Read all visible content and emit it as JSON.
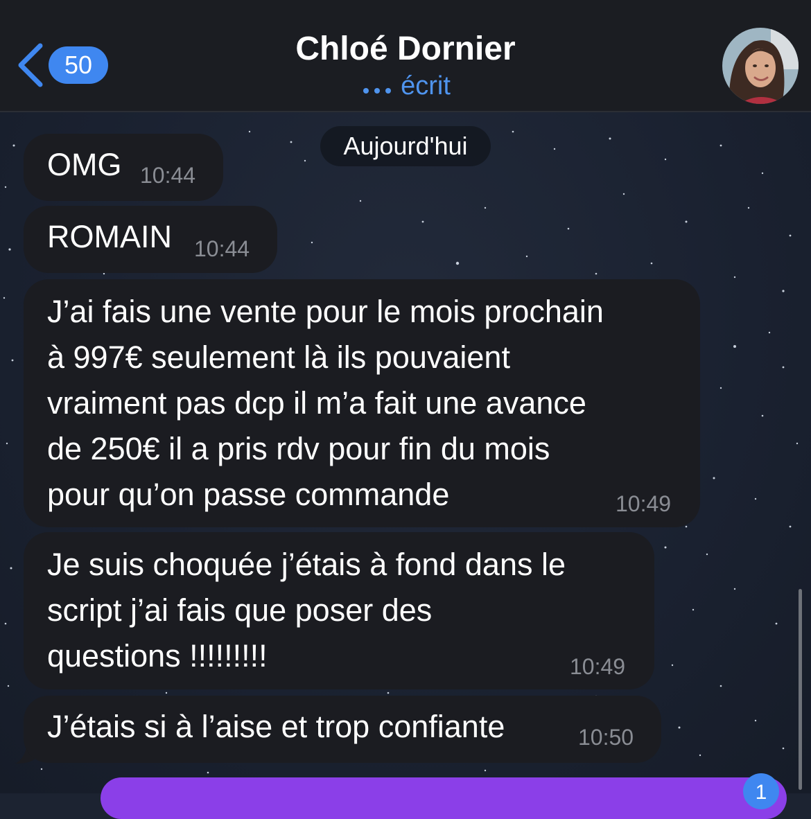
{
  "header": {
    "back_count": "50",
    "contact_name": "Chloé Dornier",
    "status": "écrit",
    "icons": [
      "chevron-left-icon",
      "typing-dots-icon",
      "avatar-photo"
    ]
  },
  "date_separator": "Aujourd'hui",
  "messages": [
    {
      "text": "OMG",
      "time": "10:44"
    },
    {
      "text": "ROMAIN",
      "time": "10:44"
    },
    {
      "text": "J’ai fais une vente pour le mois prochain\nà 997€ seulement là ils pouvaient\nvraiment pas dcp il m’a fait une avance\nde 250€ il a pris rdv pour fin du mois\npour qu’on passe commande",
      "time": "10:49"
    },
    {
      "text": "Je suis choquée j’étais à fond dans le\nscript j’ai fais que poser des\nquestions !!!!!!!!!",
      "time": "10:49"
    },
    {
      "text": "J’étais si à l’aise et trop confiante",
      "time": "10:50"
    }
  ],
  "new_messages_count": "1",
  "colors": {
    "accent_blue": "#3f87f0",
    "status_blue": "#4f94ee",
    "bubble": "#1b1c21",
    "outgoing_purple": "#8b3fe8",
    "header_bg": "#1b1d22"
  }
}
